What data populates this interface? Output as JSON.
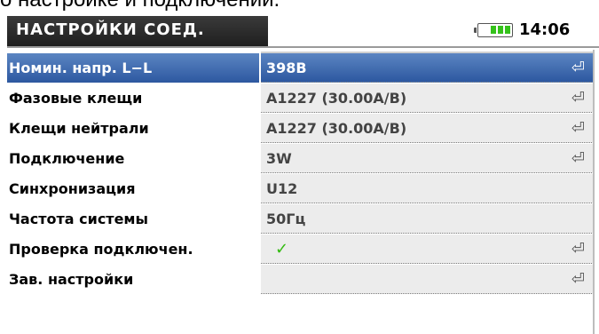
{
  "caption": "о настройке и подключении.",
  "header": {
    "title": "НАСТРОЙКИ СОЕД.",
    "time": "14:06",
    "battery_icon": "battery-icon",
    "battery_level_pct": 60,
    "battery_color": "#35c21b"
  },
  "selection_color": "#2d58a0",
  "rows": [
    {
      "label": "Номин. напр. L−L",
      "value": "398В",
      "enter": "⏎",
      "selected": true
    },
    {
      "label": "Фазовые клещи",
      "value": "A1227 (30.00A/B)",
      "enter": "⏎"
    },
    {
      "label": "Клещи нейтрали",
      "value": "A1227 (30.00A/B)",
      "enter": "⏎"
    },
    {
      "label": "Подключение",
      "value": "3W",
      "enter": "⏎"
    },
    {
      "label": "Синхронизация",
      "value": "U12",
      "enter": ""
    },
    {
      "label": "Частота системы",
      "value": "50Гц",
      "enter": ""
    },
    {
      "label": "Проверка подключен.",
      "value": "✓",
      "enter": "⏎"
    },
    {
      "label": "Зав. настройки",
      "value": "",
      "enter": "⏎"
    }
  ]
}
